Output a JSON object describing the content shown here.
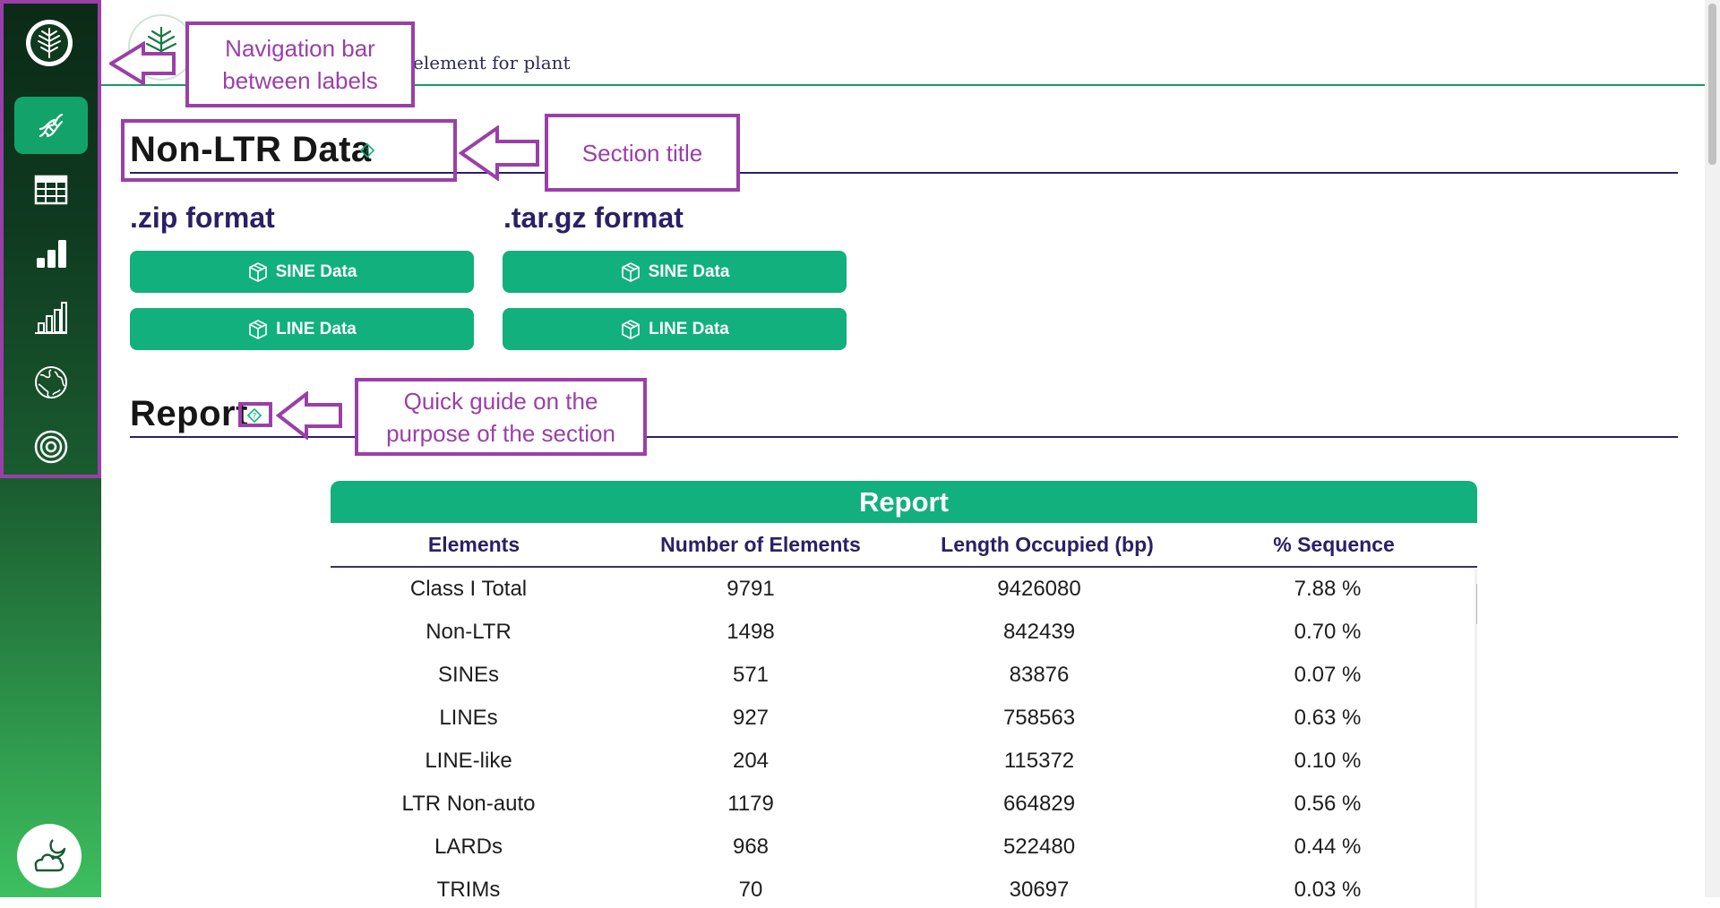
{
  "colors": {
    "brand_green": "#12b07c",
    "nav_active": "#13a36a",
    "heading_dark": "#2b2064",
    "annotation": "#9b3fa8"
  },
  "sidebar": {
    "items": [
      {
        "name": "logo",
        "icon": "tree-logo-icon"
      },
      {
        "name": "dna",
        "icon": "dna-icon",
        "active": true
      },
      {
        "name": "table",
        "icon": "table-grid-icon"
      },
      {
        "name": "bar-chart",
        "icon": "bar-chart-icon"
      },
      {
        "name": "bar-chart-outline",
        "icon": "bar-chart-outline-icon"
      },
      {
        "name": "globe",
        "icon": "globe-icon"
      },
      {
        "name": "target",
        "icon": "target-icon"
      }
    ],
    "theme_toggle": {
      "icon": "cloud-moon-icon"
    }
  },
  "header": {
    "tagline": "element for plant"
  },
  "non_ltr": {
    "title": "Non-LTR Data",
    "zip": {
      "title": ".zip format",
      "buttons": [
        "SINE Data",
        "LINE Data"
      ]
    },
    "targz": {
      "title": ".tar.gz format",
      "buttons": [
        "SINE Data",
        "LINE Data"
      ]
    }
  },
  "report": {
    "title": "Report",
    "table_title": "Report",
    "columns": [
      "Elements",
      "Number of Elements",
      "Length Occupied (bp)",
      "% Sequence"
    ],
    "rows": [
      [
        "Class I Total",
        "9791",
        "9426080",
        "7.88 %"
      ],
      [
        "Non-LTR",
        "1498",
        "842439",
        "0.70 %"
      ],
      [
        "SINEs",
        "571",
        "83876",
        "0.07 %"
      ],
      [
        "LINEs",
        "927",
        "758563",
        "0.63 %"
      ],
      [
        "LINE-like",
        "204",
        "115372",
        "0.10 %"
      ],
      [
        "LTR Non-auto",
        "1179",
        "664829",
        "0.56 %"
      ],
      [
        "LARDs",
        "968",
        "522480",
        "0.44 %"
      ],
      [
        "TRIMs",
        "70",
        "30697",
        "0.03 %"
      ]
    ]
  },
  "annotations": {
    "nav": "Navigation bar between labels",
    "section_title": "Section title",
    "quick_guide": "Quick guide on the purpose of the section"
  }
}
